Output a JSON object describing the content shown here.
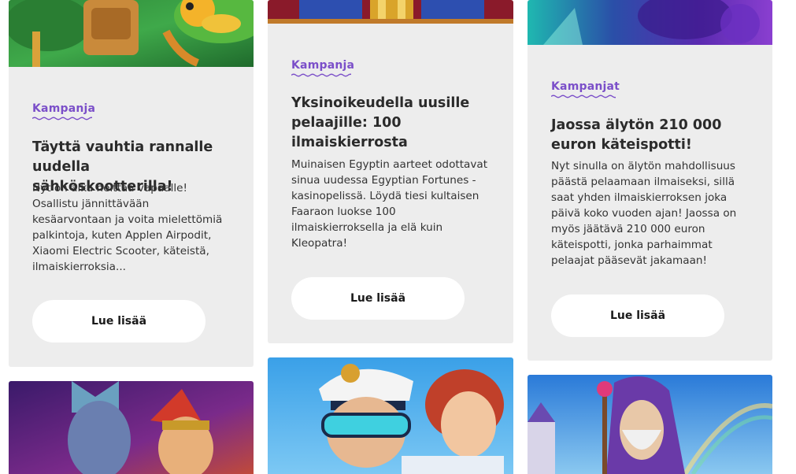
{
  "cards": [
    {
      "tag": "Kampanja",
      "title": "Täyttä vauhtia rannalle uudella sähköskootterilla!",
      "description": "Nyt on aika heittää vapaalle! Osallistu jännittävään kesäarvontaan ja voita mielettömiä palkintoja, kuten Applen Airpodit, Xiaomi Electric Scooter, käteistä, ilmaiskierroksia...",
      "button": "Lue lisää"
    },
    {
      "tag": "Kampanja",
      "title": "Yksinoikeudella uusille pelaajille: 100 ilmaiskierrosta",
      "description": "Muinaisen Egyptin aarteet odottavat sinua uudessa Egyptian Fortunes -kasinopelissä. Löydä tiesi kultaisen Faaraon luokse 100 ilmaiskierroksella ja elä kuin Kleopatra!",
      "button": "Lue lisää"
    },
    {
      "tag": "Kampanjat",
      "title": "Jaossa älytön 210 000 euron käteispotti!",
      "description": "Nyt sinulla on älytön mahdollisuus päästä pelaamaan ilmaiseksi, sillä saat yhden ilmaiskierroksen joka päivä koko vuoden ajan! Jaossa on myös jäätävä 210 000 euron käteispotti, jonka parhaimmat pelaajat pääsevät jakamaan!",
      "button": "Lue lisää"
    }
  ],
  "colors": {
    "card_bg": "#ededed",
    "tag": "#7b4fc9",
    "title": "#2b2b2b",
    "button_bg": "#ffffff"
  }
}
